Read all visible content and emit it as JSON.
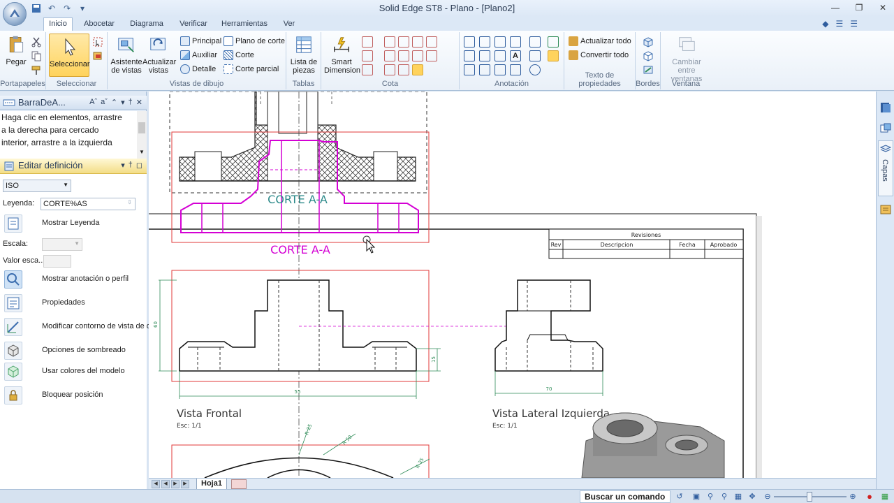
{
  "window": {
    "title": "Solid Edge ST8 - Plano - [Plano2]",
    "controls": [
      "minimize",
      "restore",
      "close"
    ]
  },
  "tabs": [
    {
      "label": "Inicio",
      "active": true
    },
    {
      "label": "Abocetar",
      "active": false
    },
    {
      "label": "Diagrama",
      "active": false
    },
    {
      "label": "Verificar",
      "active": false
    },
    {
      "label": "Herramientas",
      "active": false
    },
    {
      "label": "Ver",
      "active": false
    }
  ],
  "ribbon": {
    "portapapeles": {
      "paste": "Pegar",
      "group": "Portapapeles"
    },
    "seleccionar": {
      "select": "Seleccionar",
      "group": "Seleccionar"
    },
    "vistas": {
      "asistente_l1": "Asistente",
      "asistente_l2": "de vistas",
      "actualizar_l1": "Actualizar",
      "actualizar_l2": "vistas",
      "principal": "Principal",
      "auxiliar": "Auxiliar",
      "detalle": "Detalle",
      "plano_corte": "Plano de corte",
      "corte": "Corte",
      "corte_parcial": "Corte parcial",
      "group": "Vistas de dibujo"
    },
    "tablas": {
      "lista_l1": "Lista de",
      "lista_l2": "piezas",
      "group": "Tablas"
    },
    "cota": {
      "smart_l1": "Smart",
      "smart_l2": "Dimension",
      "group": "Cota"
    },
    "anotacion": {
      "group": "Anotación"
    },
    "texto_propiedades": {
      "actualizar": "Actualizar todo",
      "convertir": "Convertir todo",
      "group": "Texto de propiedades"
    },
    "bordes": {
      "group": "Bordes"
    },
    "ventana": {
      "cambiar_l1": "Cambiar entre",
      "cambiar_l2": "ventanas",
      "group": "Ventana"
    }
  },
  "left_panel": {
    "barra_title": "BarraDeA...",
    "hint": [
      "Haga clic en elementos, arrastre",
      "a la derecha para cercado",
      "interior, arrastre a la izquierda"
    ],
    "editar_title": "Editar definición",
    "standard": "ISO",
    "leyenda_label": "Leyenda:",
    "leyenda_value": "CORTE%AS",
    "mostrar_leyenda": "Mostrar Leyenda",
    "escala_label": "Escala:",
    "valor_escala_label": "Valor esca...",
    "mostrar_anotacion": "Mostrar anotación o perfil",
    "propiedades": "Propiedades",
    "modificar_contorno": "Modificar contorno de vista de dib",
    "opciones_sombreado": "Opciones de sombreado",
    "usar_colores": "Usar colores del modelo",
    "bloquear": "Bloquear posición"
  },
  "drawing": {
    "section_label_inner": "CORTE A-A",
    "section_label_outer": "CORTE A-A",
    "revisions_title": "Revisiones",
    "rev_cols": [
      "Rev",
      "Descripcion",
      "Fecha",
      "Aprobado"
    ],
    "dim_height": "60",
    "dim_width_front": "55",
    "dim_small": "15",
    "dim_width_side": "70",
    "dim_r1": "R 25",
    "dim_r2": "R 50",
    "dim_r3": "R 35",
    "front_view_title": "Vista Frontal",
    "front_view_scale": "Esc: 1/1",
    "side_view_title": "Vista Lateral Izquierda",
    "side_view_scale": "Esc: 1/1"
  },
  "sheet_tab": "Hoja1",
  "right_dock": {
    "layers": "Capas"
  },
  "status": {
    "search_command": "Buscar un comando"
  },
  "colors": {
    "accent": "#2f5d9e",
    "section_magenta": "#d400d4",
    "view_border_red": "#e03a3a",
    "label_teal": "#2e8b8b"
  }
}
